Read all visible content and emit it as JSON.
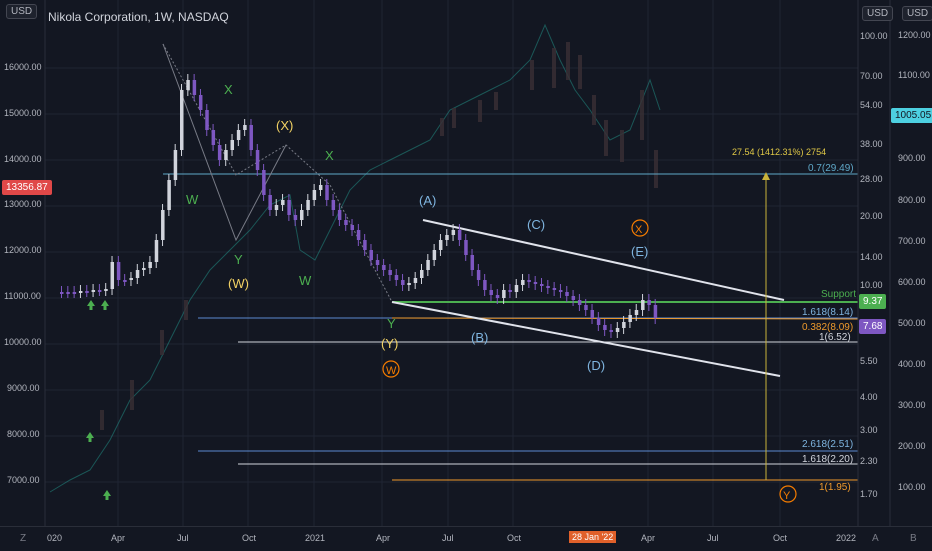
{
  "header": {
    "title": "Nikola Corporation, 1W, NASDAQ"
  },
  "currency": {
    "left": "USD",
    "right1": "USD",
    "right2": "USD"
  },
  "left_axis": {
    "ticks": [
      "16000.00",
      "15000.00",
      "14000.00",
      "13000.00",
      "12000.00",
      "11000.00",
      "10000.00",
      "9000.00",
      "8000.00",
      "7000.00"
    ],
    "current_tag": "13356.87"
  },
  "right_axis1": {
    "ticks": [
      "100.00",
      "70.00",
      "54.00",
      "38.00",
      "28.00",
      "20.00",
      "14.00",
      "10.00",
      "5.50",
      "4.00",
      "3.00",
      "2.30",
      "1.70"
    ],
    "tag_support": "9.37",
    "tag_price": "7.68"
  },
  "right_axis2": {
    "ticks": [
      "1200.00",
      "1100.00",
      "1000.00",
      "900.00",
      "800.00",
      "700.00",
      "600.00",
      "500.00",
      "400.00",
      "300.00",
      "200.00",
      "100.00"
    ],
    "tag_current": "1005.05"
  },
  "x_axis": {
    "labels": [
      "020",
      "Apr",
      "Jul",
      "Oct",
      "2021",
      "Apr",
      "Jul",
      "Oct",
      "Apr",
      "Jul",
      "Oct",
      "2022"
    ],
    "highlight": "28 Jan '22"
  },
  "annotations": {
    "W1": "W",
    "X1": "X",
    "Y1": "Y",
    "W_bracket": "(W)",
    "X_bracket": "(X)",
    "X2": "X",
    "W2": "W",
    "Y2": "Y",
    "Y_bracket": "(Y)",
    "W_circle": "W",
    "A": "(A)",
    "B": "(B)",
    "C": "(C)",
    "D": "(D)",
    "E": "(E)",
    "X_circle": "X",
    "Y_circle": "Y"
  },
  "levels": {
    "l1": "0.7(29.49)",
    "support": "Support",
    "l2": "1.618(8.14)",
    "l3": "0.382(8.09)",
    "l4": "1(6.52)",
    "l5": "2.618(2.51)",
    "l6": "1.618(2.20)",
    "l7": "1(1.95)"
  },
  "measure": {
    "label": "27.54 (1412.31%) 2754"
  },
  "bottom": {
    "left": "Z",
    "right_a": "A",
    "right_b": "B"
  },
  "colors": {
    "bg": "#131722",
    "up": "#d1d4dc",
    "down": "#7e57c2",
    "support": "#4caf50",
    "red": "#f23645"
  }
}
